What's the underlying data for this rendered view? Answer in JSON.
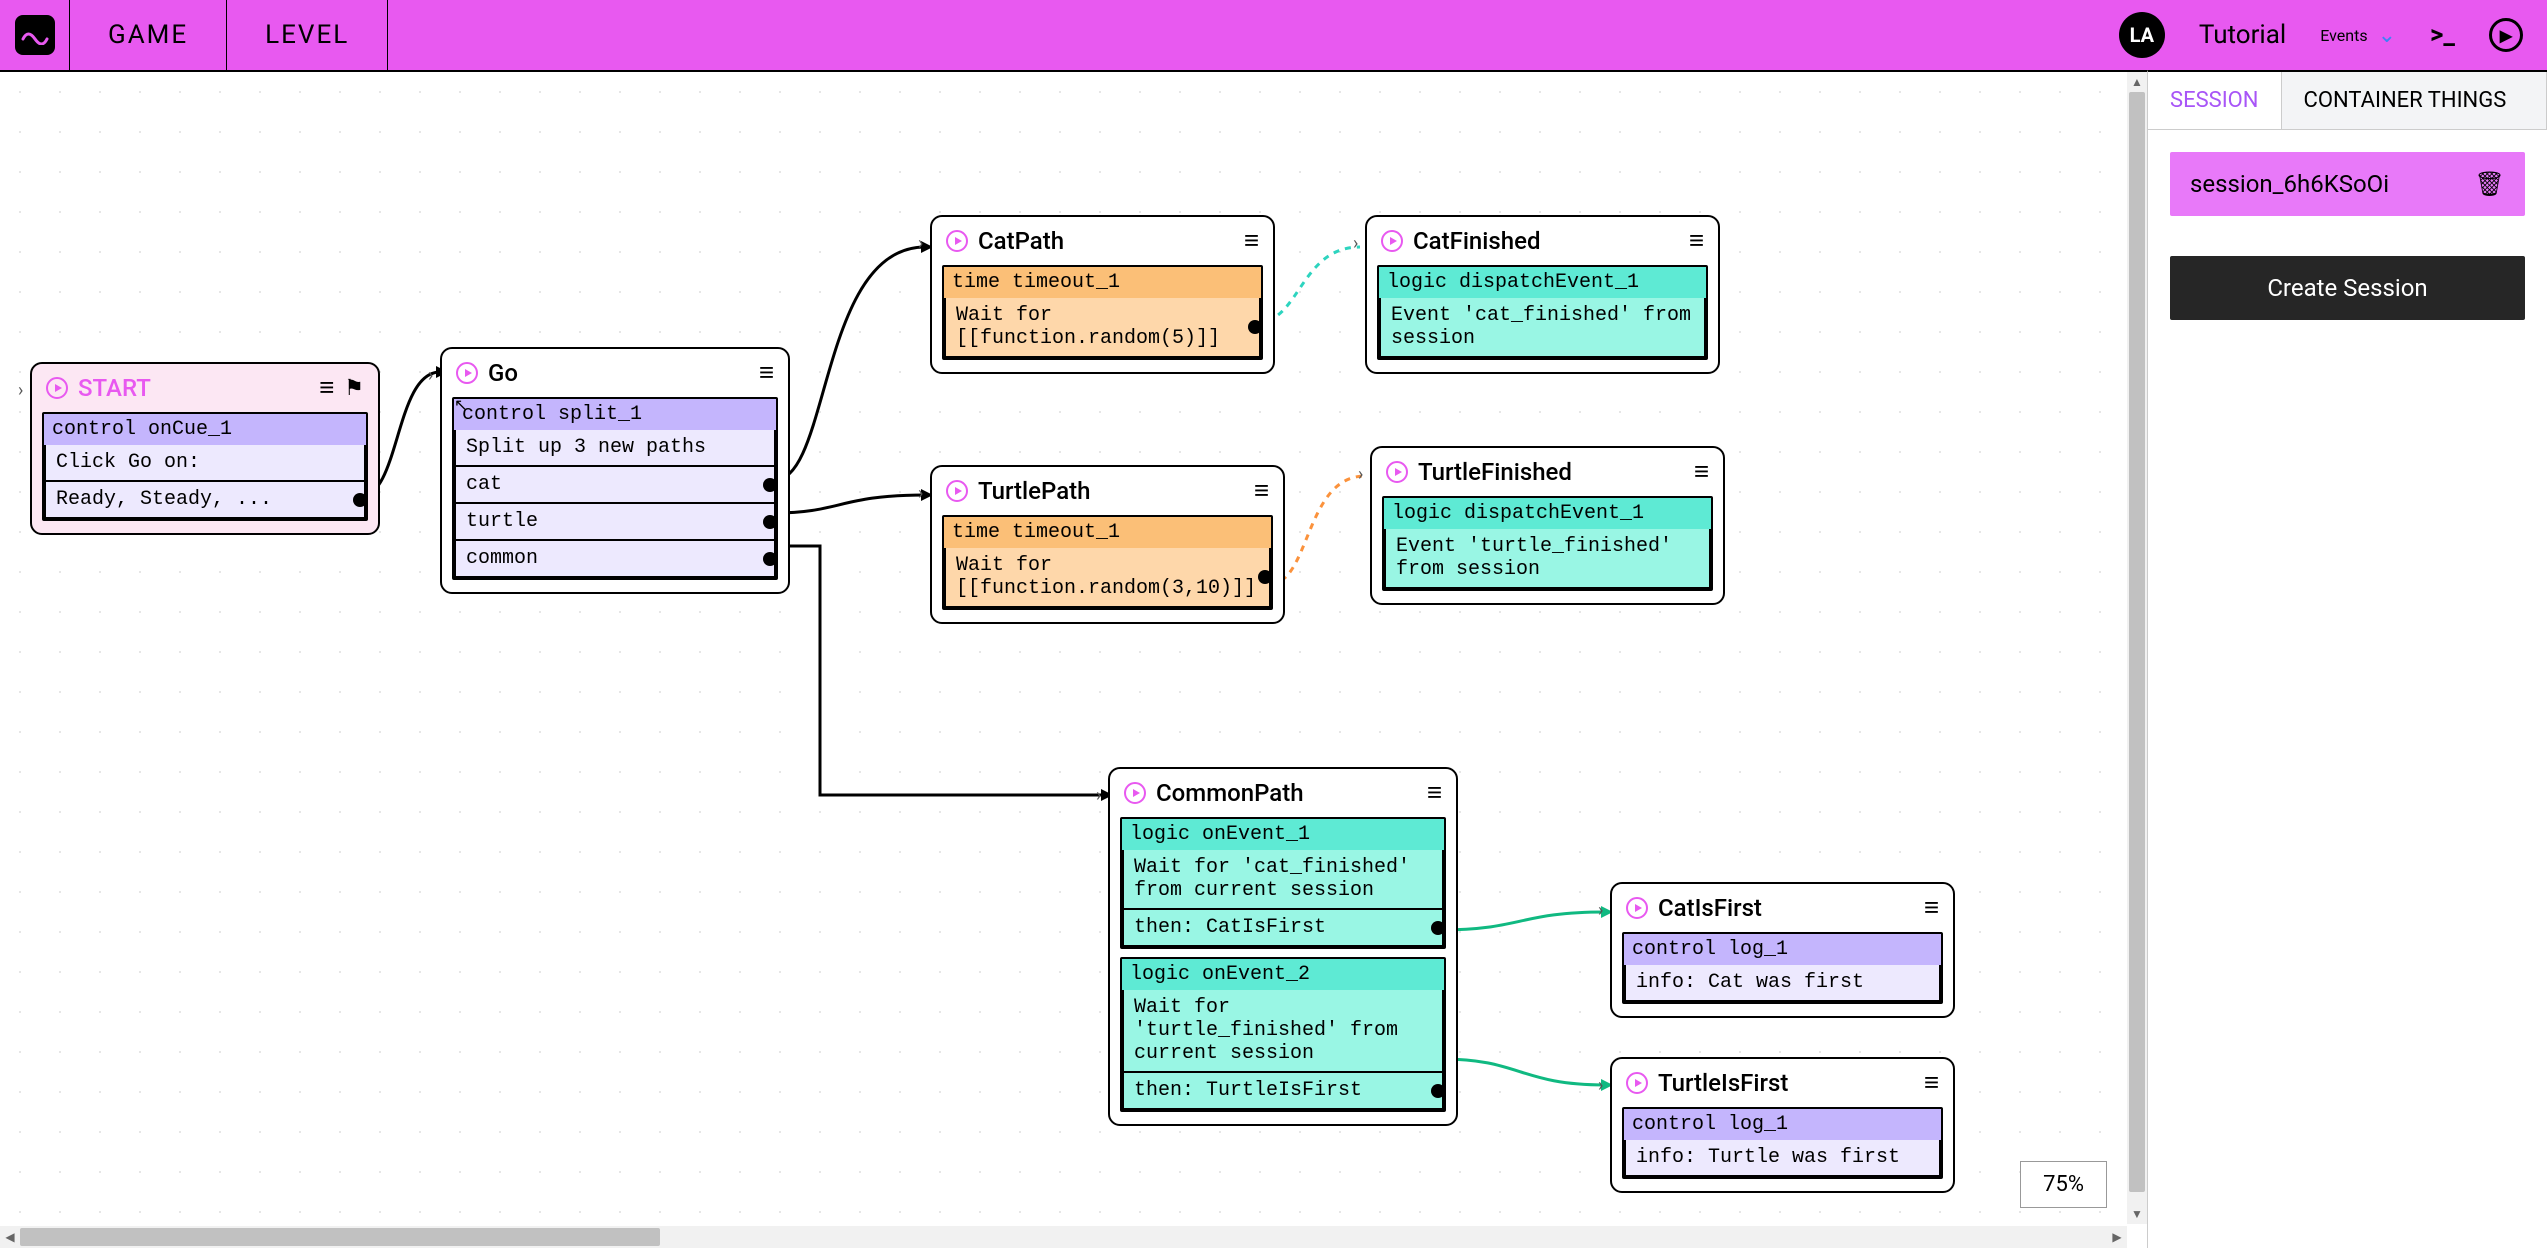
{
  "topbar": {
    "tabs": {
      "game": "GAME",
      "level": "LEVEL"
    },
    "avatar": "LA",
    "tutorial": "Tutorial",
    "events": "Events"
  },
  "sidebar": {
    "tab_session": "SESSION",
    "tab_container": "CONTAINER THINGS",
    "session_id": "session_6h6KSoOi",
    "create_btn": "Create Session"
  },
  "zoom": "75%",
  "nodes": {
    "start": {
      "title": "START",
      "block_head": "control onCue_1",
      "line1": "Click Go on:",
      "line2": "Ready, Steady, ..."
    },
    "go": {
      "title": "Go",
      "block_head": "control split_1",
      "body": "Split up 3 new paths",
      "r1": "cat",
      "r2": "turtle",
      "r3": "common"
    },
    "catpath": {
      "title": "CatPath",
      "block_head": "time timeout_1",
      "body": "Wait for [[function.random(5)]]"
    },
    "turtlepath": {
      "title": "TurtlePath",
      "block_head": "time timeout_1",
      "body": "Wait for [[function.random(3,10)]]"
    },
    "catfin": {
      "title": "CatFinished",
      "block_head": "logic dispatchEvent_1",
      "body": "Event 'cat_finished' from session"
    },
    "turtfin": {
      "title": "TurtleFinished",
      "block_head": "logic dispatchEvent_1",
      "body": "Event 'turtle_finished' from session"
    },
    "common": {
      "title": "CommonPath",
      "e1_head": "logic onEvent_1",
      "e1_body": "Wait for 'cat_finished' from current session",
      "e1_then": "then: CatIsFirst",
      "e2_head": "logic onEvent_2",
      "e2_body": "Wait for 'turtle_finished' from current session",
      "e2_then": "then: TurtleIsFirst"
    },
    "catfirst": {
      "title": "CatIsFirst",
      "block_head": "control log_1",
      "body": "info: Cat was first"
    },
    "turtfirst": {
      "title": "TurtleIsFirst",
      "block_head": "control log_1",
      "body": "info: Turtle was first"
    }
  }
}
